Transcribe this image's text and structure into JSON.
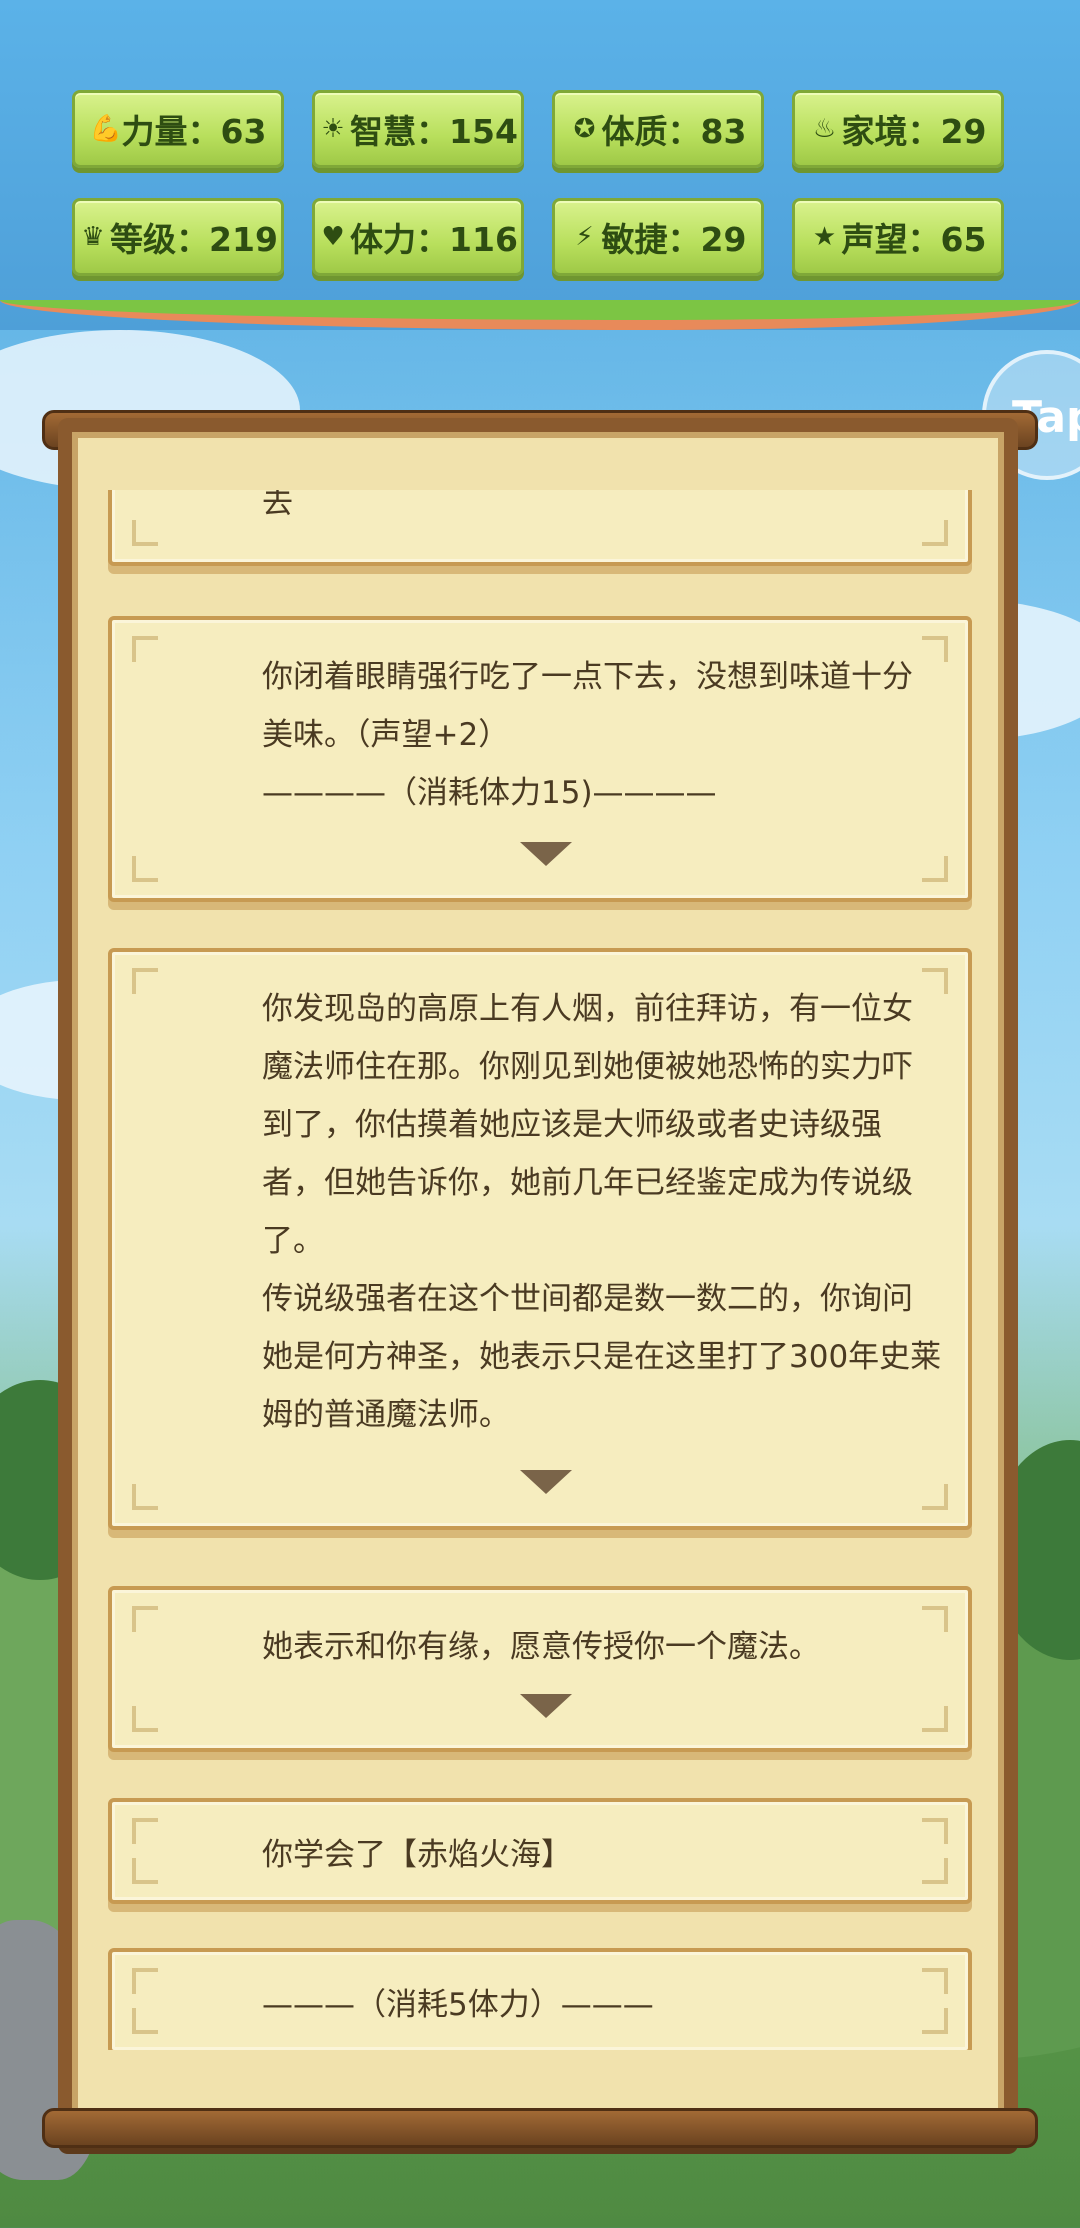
{
  "stats": [
    {
      "icon": "strength-icon",
      "glyph": "💪",
      "label": "力量：63"
    },
    {
      "icon": "wisdom-icon",
      "glyph": "☀",
      "label": "智慧：154"
    },
    {
      "icon": "constitution-icon",
      "glyph": "✪",
      "label": "体质：83"
    },
    {
      "icon": "family-icon",
      "glyph": "♨",
      "label": "家境：29"
    },
    {
      "icon": "level-crown-icon",
      "glyph": "♛",
      "label": "等级：219"
    },
    {
      "icon": "stamina-heart-icon",
      "glyph": "♥",
      "label": "体力：116"
    },
    {
      "icon": "agility-bolt-icon",
      "glyph": "⚡",
      "label": "敏捷：29"
    },
    {
      "icon": "reputation-star-icon",
      "glyph": "★",
      "label": "声望：65"
    }
  ],
  "tap_label": "Tap",
  "cards": [
    {
      "text": "去"
    },
    {
      "text": "你闭着眼睛强行吃了一点下去，没想到味道十分美味。（声望+2）\n————（消耗体力15)————"
    },
    {
      "text": "你发现岛的高原上有人烟，前往拜访，有一位女魔法师住在那。你刚见到她便被她恐怖的实力吓到了，你估摸着她应该是大师级或者史诗级强者，但她告诉你，她前几年已经鉴定成为传说级了。\n传说级强者在这个世间都是数一数二的，你询问她是何方神圣，她表示只是在这里打了300年史莱姆的普通魔法师。"
    },
    {
      "text": "她表示和你有缘，愿意传授你一个魔法。"
    },
    {
      "text": "你学会了【赤焰火海】"
    },
    {
      "text": "———（消耗5体力）———"
    }
  ]
}
